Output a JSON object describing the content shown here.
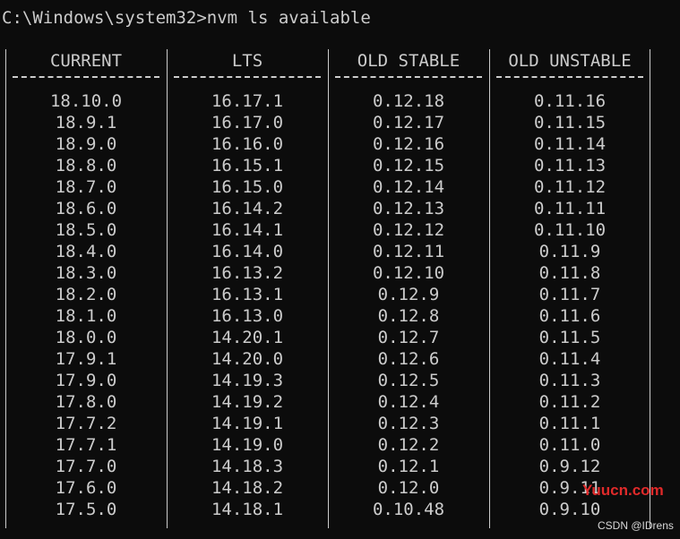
{
  "terminal": {
    "prompt_line": "C:\\Windows\\system32>nvm ls available"
  },
  "table": {
    "columns": [
      {
        "header": "CURRENT",
        "separator": "--------------",
        "values": [
          "18.10.0",
          "18.9.1",
          "18.9.0",
          "18.8.0",
          "18.7.0",
          "18.6.0",
          "18.5.0",
          "18.4.0",
          "18.3.0",
          "18.2.0",
          "18.1.0",
          "18.0.0",
          "17.9.1",
          "17.9.0",
          "17.8.0",
          "17.7.2",
          "17.7.1",
          "17.7.0",
          "17.6.0",
          "17.5.0"
        ]
      },
      {
        "header": "LTS",
        "separator": "--------------",
        "values": [
          "16.17.1",
          "16.17.0",
          "16.16.0",
          "16.15.1",
          "16.15.0",
          "16.14.2",
          "16.14.1",
          "16.14.0",
          "16.13.2",
          "16.13.1",
          "16.13.0",
          "14.20.1",
          "14.20.0",
          "14.19.3",
          "14.19.2",
          "14.19.1",
          "14.19.0",
          "14.18.3",
          "14.18.2",
          "14.18.1"
        ]
      },
      {
        "header": "OLD STABLE",
        "separator": "--------------",
        "values": [
          "0.12.18",
          "0.12.17",
          "0.12.16",
          "0.12.15",
          "0.12.14",
          "0.12.13",
          "0.12.12",
          "0.12.11",
          "0.12.10",
          "0.12.9",
          "0.12.8",
          "0.12.7",
          "0.12.6",
          "0.12.5",
          "0.12.4",
          "0.12.3",
          "0.12.2",
          "0.12.1",
          "0.12.0",
          "0.10.48"
        ]
      },
      {
        "header": "OLD UNSTABLE",
        "separator": "--------------",
        "values": [
          "0.11.16",
          "0.11.15",
          "0.11.14",
          "0.11.13",
          "0.11.12",
          "0.11.11",
          "0.11.10",
          "0.11.9",
          "0.11.8",
          "0.11.7",
          "0.11.6",
          "0.11.5",
          "0.11.4",
          "0.11.3",
          "0.11.2",
          "0.11.1",
          "0.11.0",
          "0.9.12",
          "0.9.11",
          "0.9.10"
        ]
      }
    ]
  },
  "watermarks": {
    "site": "Yuucn.com",
    "csdn": "CSDN @IDrens"
  },
  "colors": {
    "background": "#0c0c0c",
    "text": "#cccccc",
    "watermark_red": "#e02a2a"
  }
}
